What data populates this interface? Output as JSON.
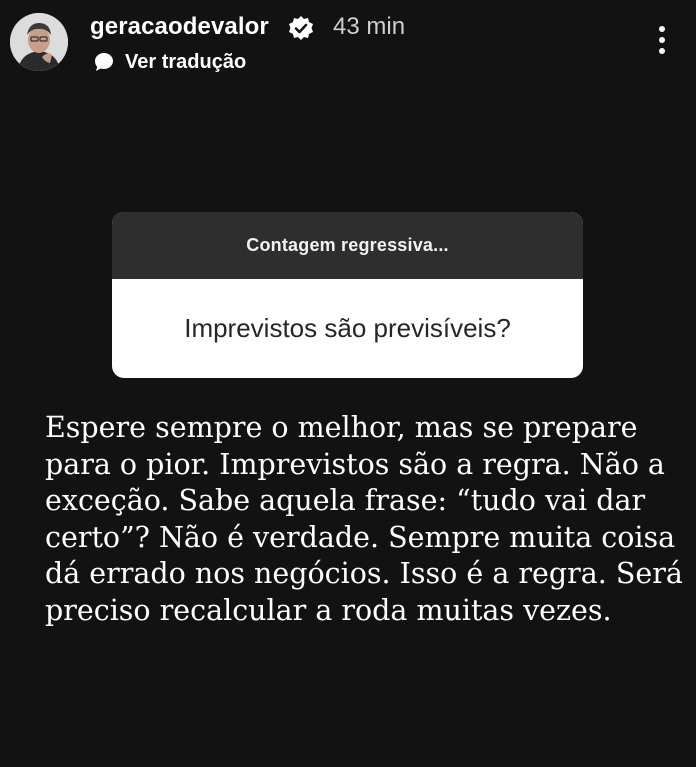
{
  "header": {
    "username": "geracaodevalor",
    "time": "43 min",
    "translate_label": "Ver tradução"
  },
  "question": {
    "title": "Contagem regressiva...",
    "text": "Imprevistos são previsíveis?"
  },
  "answer": {
    "lines": [
      "Espere sempre o melhor, mas se prepare",
      "para o pior. Imprevistos são a regra. Não a",
      "exceção. Sabe aquela frase: “tudo vai dar",
      "certo”? Não é verdade. Sempre muita coisa",
      "dá errado nos negócios. Isso é a regra. Será",
      "preciso recalcular a roda muitas vezes."
    ]
  },
  "colors": {
    "background": "#121212",
    "card_header": "#2e2e2e",
    "card_body": "#ffffff"
  },
  "icons": [
    "avatar",
    "verified-badge-icon",
    "translate-bubble-icon",
    "more-options-icon"
  ]
}
